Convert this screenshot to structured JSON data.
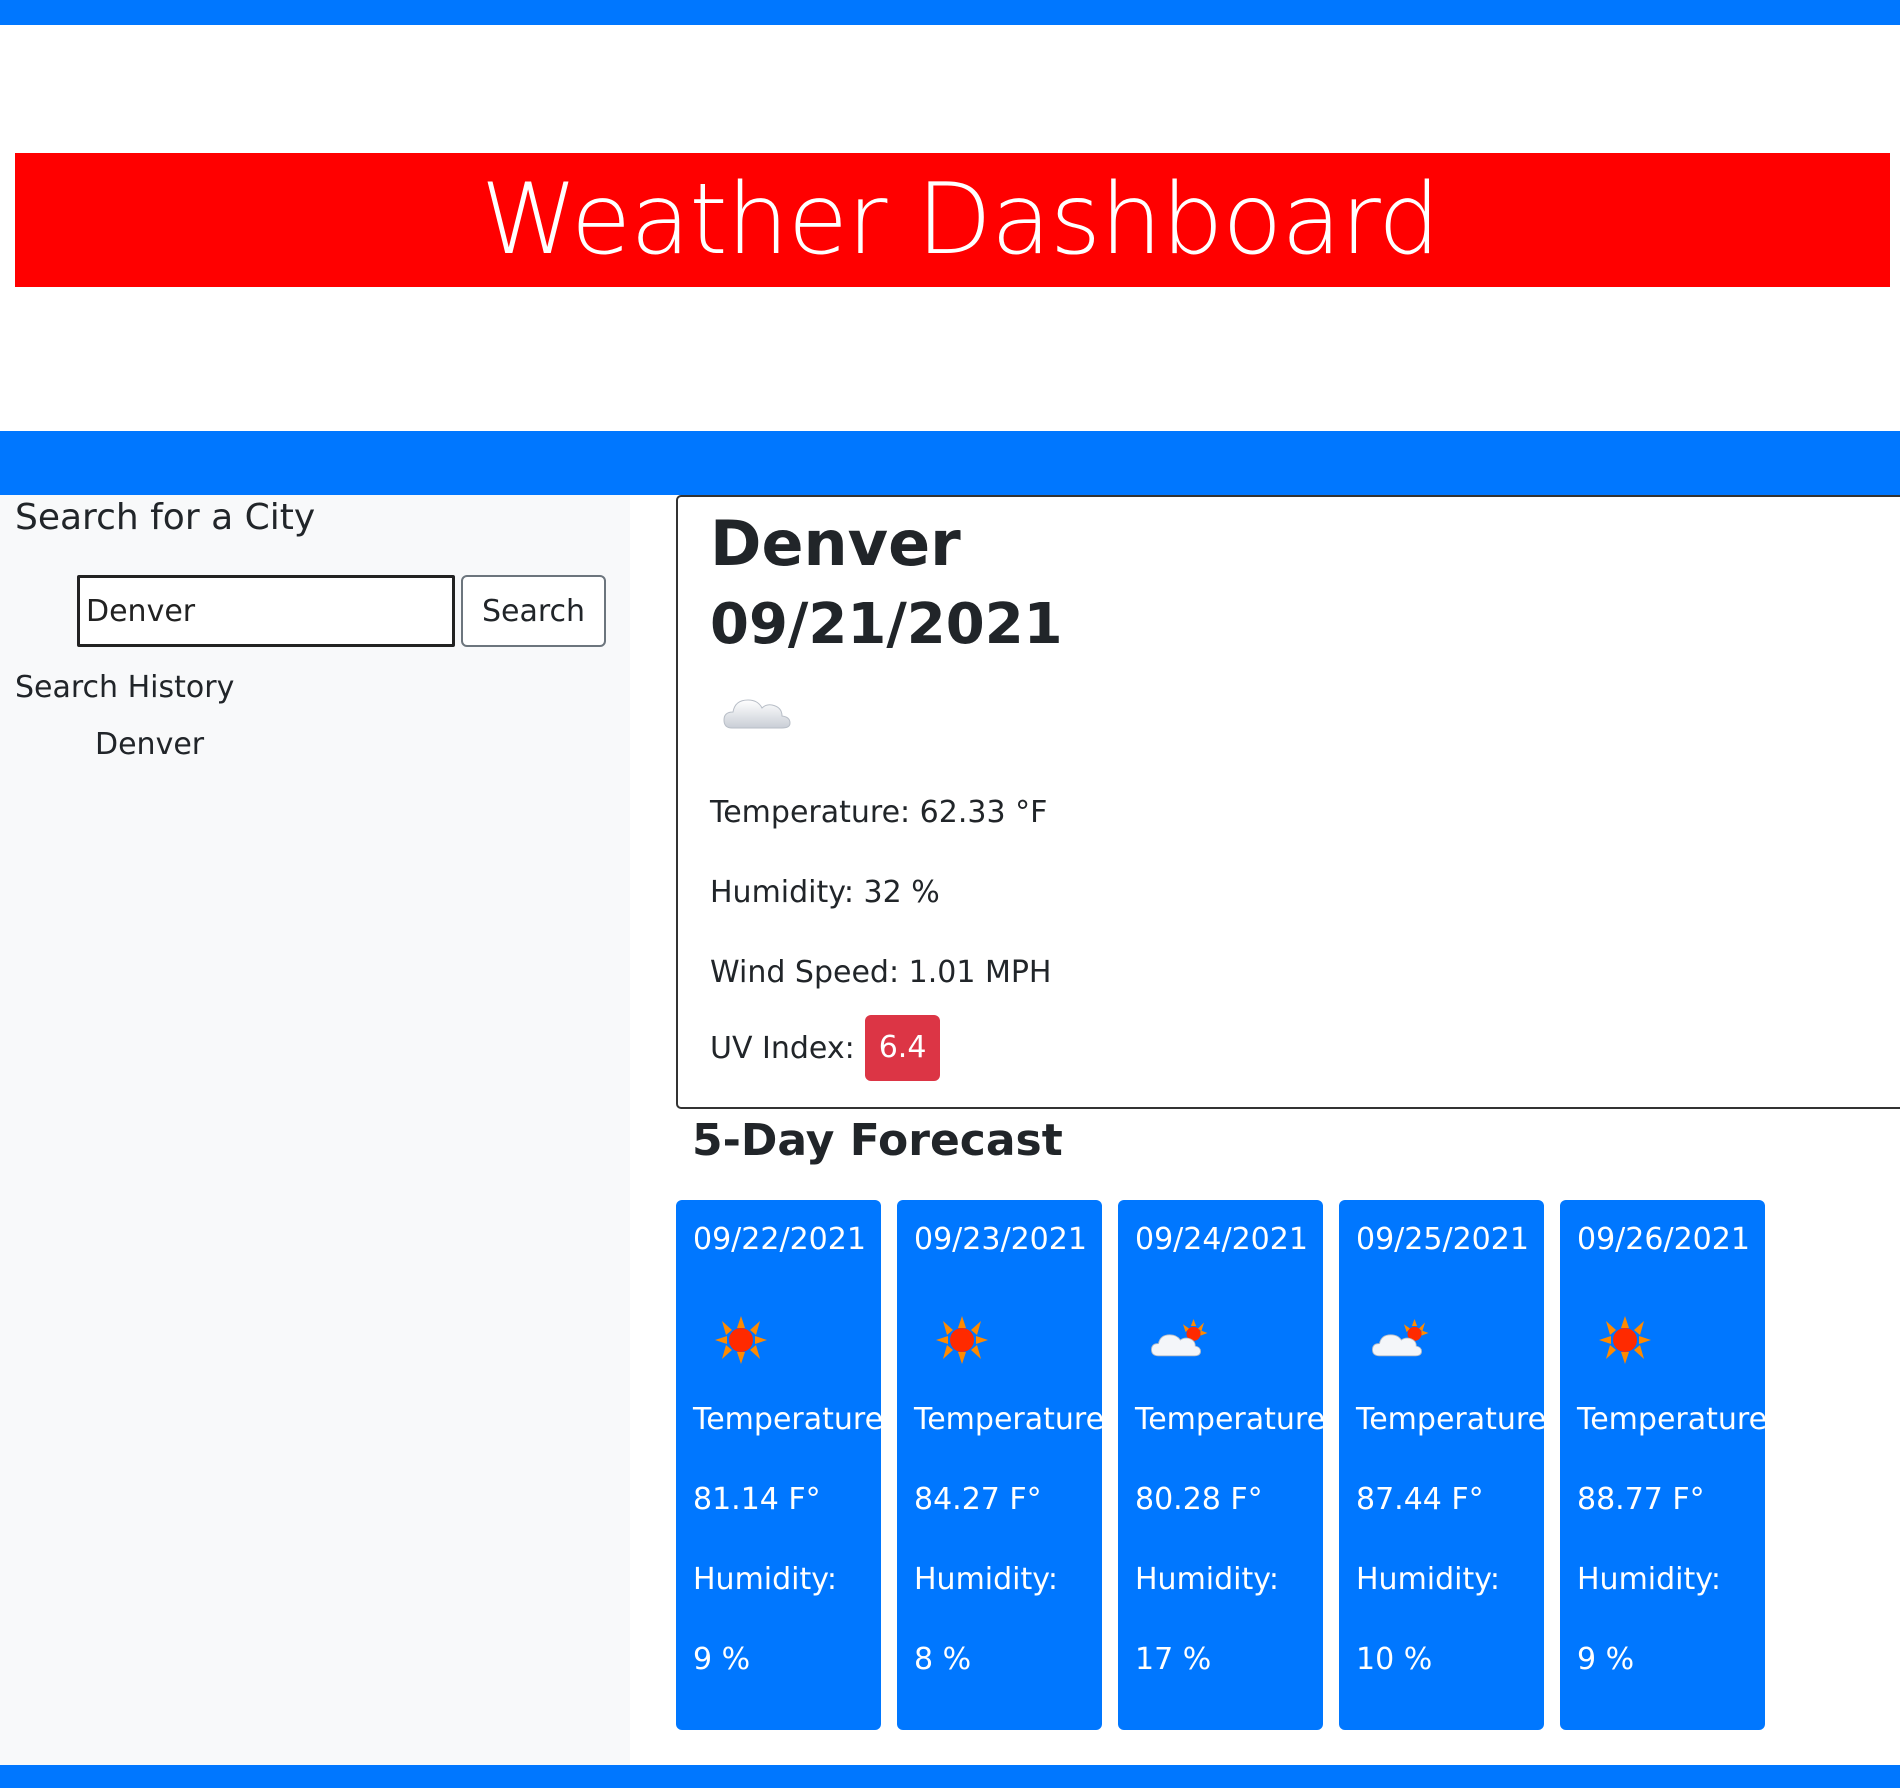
{
  "header": {
    "title": "Weather Dashboard"
  },
  "sidebar": {
    "search_heading": "Search for a City",
    "search_value": "Denver",
    "search_button": "Search",
    "history_heading": "Search History",
    "history": [
      "Denver"
    ]
  },
  "current": {
    "city": "Denver",
    "date": "09/21/2021",
    "icon": "cloud-icon",
    "temperature": "Temperature: 62.33 °F",
    "humidity": "Humidity: 32 %",
    "wind": "Wind Speed: 1.01 MPH",
    "uv_label": "UV Index:",
    "uv_value": "6.4",
    "uv_color": "#dc3545"
  },
  "forecast": {
    "heading": "5-Day Forecast",
    "days": [
      {
        "date": "09/22/2021",
        "icon": "sun-icon",
        "temp_label": "Temperature:",
        "temp": "81.14 F°",
        "humidity_label": "Humidity:",
        "humidity": "9 %"
      },
      {
        "date": "09/23/2021",
        "icon": "sun-icon",
        "temp_label": "Temperature:",
        "temp": "84.27 F°",
        "humidity_label": "Humidity:",
        "humidity": "8 %"
      },
      {
        "date": "09/24/2021",
        "icon": "partly-cloudy-icon",
        "temp_label": "Temperature:",
        "temp": "80.28 F°",
        "humidity_label": "Humidity:",
        "humidity": "17 %"
      },
      {
        "date": "09/25/2021",
        "icon": "partly-cloudy-icon",
        "temp_label": "Temperature:",
        "temp": "87.44 F°",
        "humidity_label": "Humidity:",
        "humidity": "10 %"
      },
      {
        "date": "09/26/2021",
        "icon": "sun-icon",
        "temp_label": "Temperature:",
        "temp": "88.77 F°",
        "humidity_label": "Humidity:",
        "humidity": "9 %"
      }
    ]
  },
  "colors": {
    "accent": "#0077ff",
    "banner": "#ff0000"
  }
}
